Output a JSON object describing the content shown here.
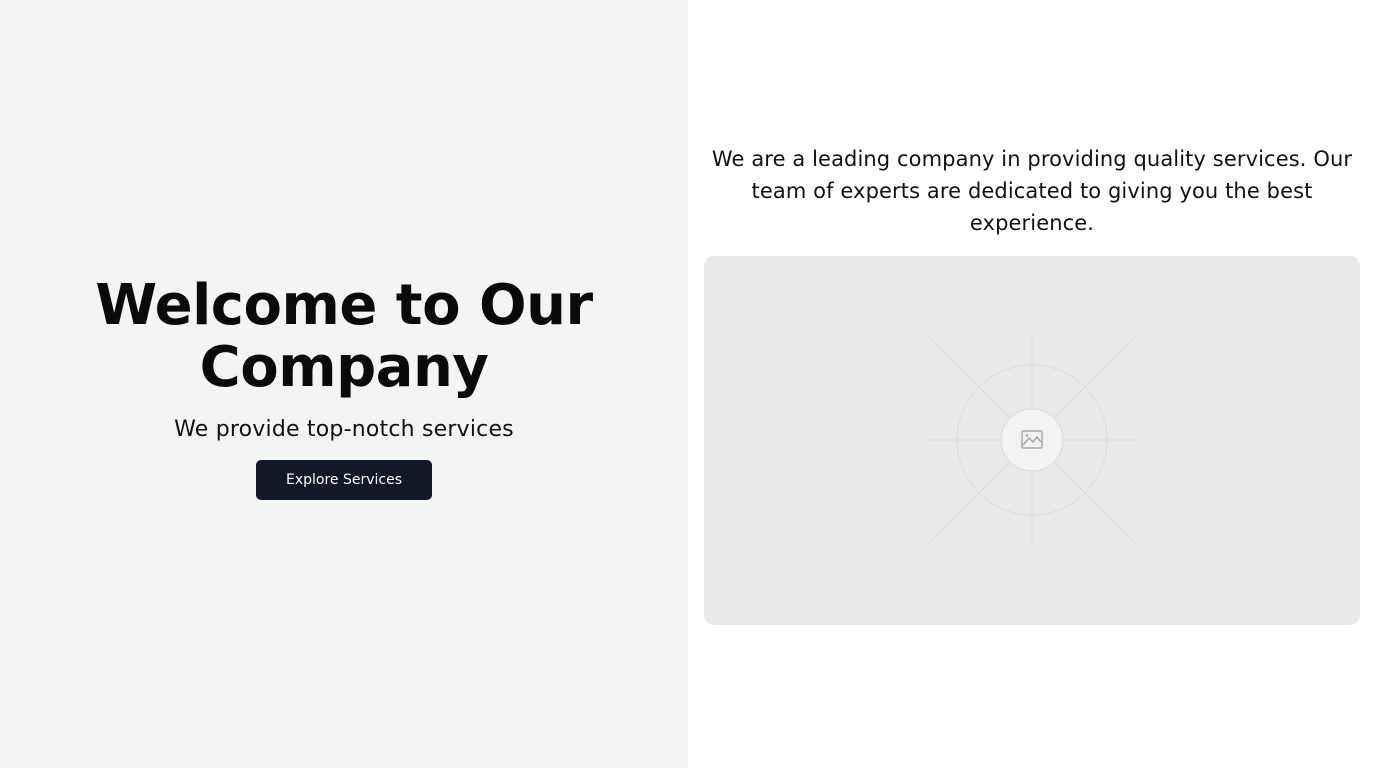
{
  "hero": {
    "title": "Welcome to Our Company",
    "subtitle": "We provide top-notch services",
    "cta_label": "Explore Services"
  },
  "about": {
    "description": "We are a leading company in providing quality services. Our team of experts are dedicated to giving you the best experience."
  },
  "media": {
    "placeholder_icon": "image-icon"
  },
  "colors": {
    "left_background": "#f3f4f6",
    "button_background": "#111827",
    "placeholder_background": "#e9e9e9"
  }
}
